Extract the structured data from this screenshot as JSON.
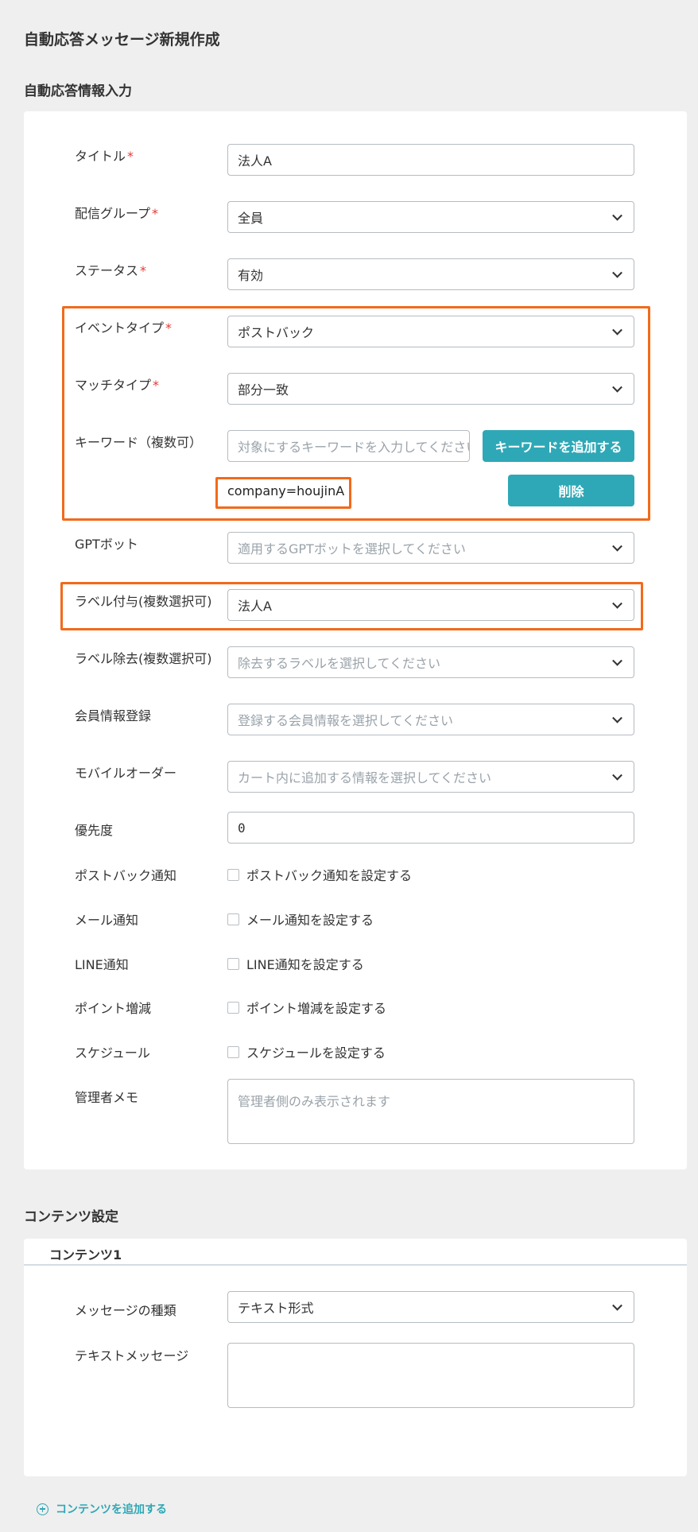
{
  "page": {
    "title": "自動応答メッセージ新規作成"
  },
  "info_section": {
    "heading": "自動応答情報入力",
    "title_label": "タイトル",
    "title_value": "法人A",
    "group_label": "配信グループ",
    "group_value": "全員",
    "status_label": "ステータス",
    "status_value": "有効",
    "event_label": "イベントタイプ",
    "event_value": "ポストバック",
    "match_label": "マッチタイプ",
    "match_value": "部分一致",
    "keyword_label": "キーワード（複数可）",
    "keyword_placeholder": "対象にするキーワードを入力してください",
    "keyword_add_button": "キーワードを追加する",
    "keyword_tag": "company=houjinA",
    "keyword_delete_button": "削除",
    "gpt_label": "GPTボット",
    "gpt_placeholder": "適用するGPTボットを選択してください",
    "label_add_label": "ラベル付与(複数選択可)",
    "label_add_value": "法人A",
    "label_remove_label": "ラベル除去(複数選択可)",
    "label_remove_placeholder": "除去するラベルを選択してください",
    "member_label": "会員情報登録",
    "member_placeholder": "登録する会員情報を選択してください",
    "mobile_label": "モバイルオーダー",
    "mobile_placeholder": "カート内に追加する情報を選択してください",
    "priority_label": "優先度",
    "priority_value": "0",
    "postback_notify_label": "ポストバック通知",
    "postback_notify_check": "ポストバック通知を設定する",
    "mail_notify_label": "メール通知",
    "mail_notify_check": "メール通知を設定する",
    "line_notify_label": "LINE通知",
    "line_notify_check": "LINE通知を設定する",
    "point_label": "ポイント増減",
    "point_check": "ポイント増減を設定する",
    "schedule_label": "スケジュール",
    "schedule_check": "スケジュールを設定する",
    "memo_label": "管理者メモ",
    "memo_placeholder": "管理者側のみ表示されます",
    "required_mark": "*"
  },
  "content_section": {
    "heading": "コンテンツ設定",
    "tab_label": "コンテンツ1",
    "message_type_label": "メッセージの種類",
    "message_type_value": "テキスト形式",
    "text_message_label": "テキストメッセージ",
    "add_content_link": "コンテンツを追加する"
  },
  "colors": {
    "accent": "#2ea8b6",
    "highlight": "#f26a1b",
    "required": "#e53935"
  }
}
